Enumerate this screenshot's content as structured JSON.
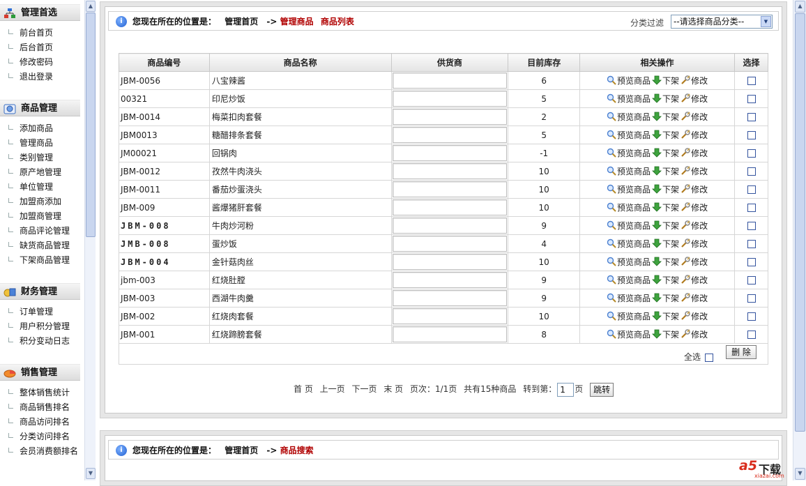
{
  "left_menu": {
    "sections": [
      {
        "title": "管理首选",
        "icon": "sitemap-icon",
        "items": [
          "前台首页",
          "后台首页",
          "修改密码",
          "退出登录"
        ]
      },
      {
        "title": "商品管理",
        "icon": "goods-icon",
        "items": [
          "添加商品",
          "管理商品",
          "类别管理",
          "原产地管理",
          "单位管理",
          "加盟商添加",
          "加盟商管理",
          "商品评论管理",
          "缺货商品管理",
          "下架商品管理"
        ]
      },
      {
        "title": "财务管理",
        "icon": "finance-icon",
        "items": [
          "订单管理",
          "用户积分管理",
          "积分变动日志"
        ]
      },
      {
        "title": "销售管理",
        "icon": "sales-icon",
        "items": [
          "整体销售统计",
          "商品销售排名",
          "商品访问排名",
          "分类访问排名",
          "会员消费额排名"
        ]
      }
    ]
  },
  "breadcrumb": {
    "prefix": "您现在所在的位置是：",
    "home": "管理首页",
    "arrow": "->",
    "section": "管理商品",
    "page": "商品列表"
  },
  "filter": {
    "label": "分类过滤",
    "selected": "--请选择商品分类--"
  },
  "table": {
    "headers": [
      "商品编号",
      "商品名称",
      "供货商",
      "目前库存",
      "相关操作",
      "选择"
    ],
    "actions": {
      "preview": "预览商品",
      "offshelf": "下架",
      "edit": "修改"
    },
    "rows": [
      {
        "code": "JBM-0056",
        "name": "八宝辣酱",
        "supplier": "",
        "stock": "6",
        "mono": false
      },
      {
        "code": "00321",
        "name": "印尼炒饭",
        "supplier": "",
        "stock": "5",
        "mono": false
      },
      {
        "code": "JBM-0014",
        "name": "梅菜扣肉套餐",
        "supplier": "",
        "stock": "2",
        "mono": false
      },
      {
        "code": "JBM0013",
        "name": "糖醋排条套餐",
        "supplier": "",
        "stock": "5",
        "mono": false
      },
      {
        "code": "JM00021",
        "name": "回锅肉",
        "supplier": "",
        "stock": "-1",
        "mono": false
      },
      {
        "code": "JBM-0012",
        "name": "孜然牛肉浇头",
        "supplier": "",
        "stock": "10",
        "mono": false
      },
      {
        "code": "JBM-0011",
        "name": "番茄炒蛋浇头",
        "supplier": "",
        "stock": "10",
        "mono": false
      },
      {
        "code": "JBM-009",
        "name": "酱爆猪肝套餐",
        "supplier": "",
        "stock": "10",
        "mono": false
      },
      {
        "code": "JBM-008",
        "name": "牛肉炒河粉",
        "supplier": "",
        "stock": "9",
        "mono": true
      },
      {
        "code": "JMB-008",
        "name": "蛋炒饭",
        "supplier": "",
        "stock": "4",
        "mono": true
      },
      {
        "code": "JBM-004",
        "name": "金针菇肉丝",
        "supplier": "",
        "stock": "10",
        "mono": true
      },
      {
        "code": "jbm-003",
        "name": "红烧肚膛",
        "supplier": "",
        "stock": "9",
        "mono": false
      },
      {
        "code": "JBM-003",
        "name": "西湖牛肉羹",
        "supplier": "",
        "stock": "9",
        "mono": false
      },
      {
        "code": "JBM-002",
        "name": "红烧肉套餐",
        "supplier": "",
        "stock": "10",
        "mono": false
      },
      {
        "code": "JBM-001",
        "name": "红烧蹄膀套餐",
        "supplier": "",
        "stock": "8",
        "mono": false
      }
    ]
  },
  "footer": {
    "select_all": "全选",
    "delete": "删 除"
  },
  "pager": {
    "first": "首 页",
    "prev": "上一页",
    "next": "下一页",
    "last": "末 页",
    "page_info": "页次：1/1页",
    "total": "共有15种商品",
    "goto_label": "转到第：",
    "goto_value": "1",
    "goto_suffix": "页",
    "go": "跳转"
  },
  "search_panel": {
    "prefix": "您现在所在的位置是：",
    "home": "管理首页",
    "arrow": "->",
    "page": "商品搜索"
  },
  "watermark": {
    "brand": "a5",
    "text": "下载",
    "site": "xiazai.com"
  }
}
